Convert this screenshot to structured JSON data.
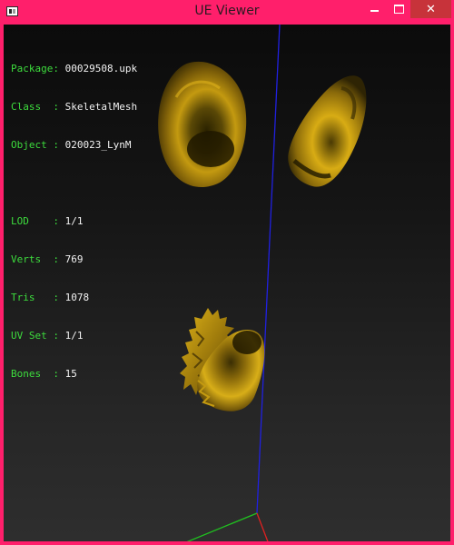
{
  "window": {
    "title": "UE Viewer"
  },
  "info": {
    "package": {
      "label": "Package: ",
      "value": "00029508.upk"
    },
    "class": {
      "label": "Class  : ",
      "value": "SkeletalMesh"
    },
    "object": {
      "label": "Object : ",
      "value": "020023_LynM"
    },
    "lod": {
      "label": "LOD    : ",
      "value": "1/1"
    },
    "verts": {
      "label": "Verts  : ",
      "value": "769"
    },
    "tris": {
      "label": "Tris   : ",
      "value": "1078"
    },
    "uvset": {
      "label": "UV Set : ",
      "value": "1/1"
    },
    "bones": {
      "label": "Bones  : ",
      "value": "15"
    }
  },
  "colors": {
    "frame": "#ff1f6b",
    "close_button": "#c7333a",
    "label_text": "#3ddc3d",
    "value_text": "#f2f2f2",
    "axis_x": "#e02020",
    "axis_y": "#20c020",
    "axis_z": "#2020e0",
    "mesh": "#b08a10"
  },
  "icons": {
    "app": "app-icon",
    "minimize": "minimize-icon",
    "maximize": "maximize-icon",
    "close": "close-icon"
  }
}
